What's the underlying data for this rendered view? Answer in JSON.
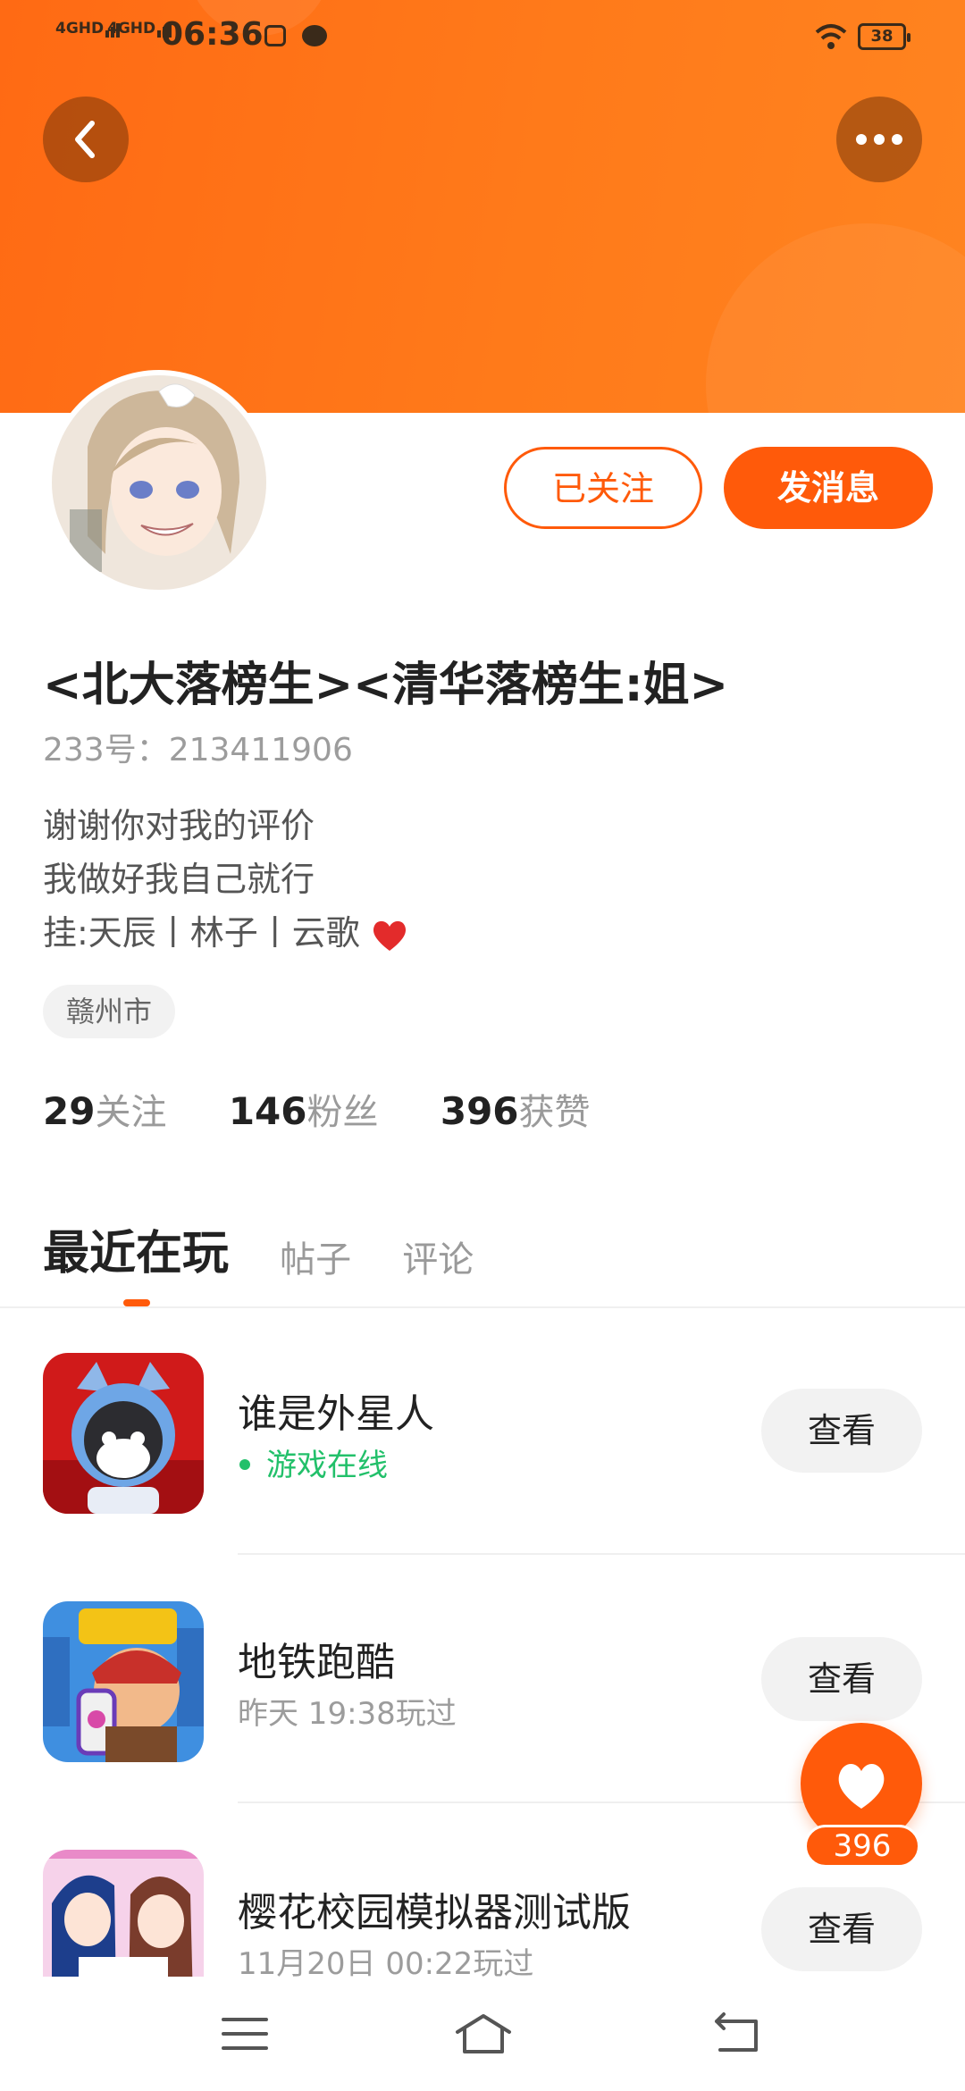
{
  "status_bar": {
    "signal1": "4GHD",
    "signal2": "4GHD",
    "time": "06:36",
    "battery": "38",
    "icons": [
      "app-icon",
      "message-bubble-icon",
      "wifi-icon",
      "battery-icon"
    ]
  },
  "header": {
    "back_icon": "chevron-left-icon",
    "more_icon": "more-dots-icon",
    "banner_color": "#ff7417"
  },
  "profile": {
    "follow_label": "已关注",
    "message_label": "发消息",
    "username": "<北大落榜生><清华落榜生:姐>",
    "uid": "233号：213411906",
    "bio": [
      "谢谢你对我的评价",
      "我做好我自己就行",
      "挂:天辰丨林子丨云歌"
    ],
    "location": "赣州市"
  },
  "stats": [
    {
      "num": "29",
      "label": "关注"
    },
    {
      "num": "146",
      "label": "粉丝"
    },
    {
      "num": "396",
      "label": "获赞"
    }
  ],
  "tabs": [
    {
      "label": "最近在玩",
      "active": true
    },
    {
      "label": "帖子",
      "active": false
    },
    {
      "label": "评论",
      "active": false
    }
  ],
  "games": [
    {
      "name": "谁是外星人",
      "status": "游戏在线",
      "online": true,
      "button": "查看"
    },
    {
      "name": "地铁跑酷",
      "status": "昨天 19:38玩过",
      "online": false,
      "button": "查看"
    },
    {
      "name": "樱花校园模拟器测试版",
      "status": "11月20日 00:22玩过",
      "online": false,
      "button": "查看"
    }
  ],
  "like_fab": {
    "count": "396",
    "icon": "heart-icon"
  },
  "nav": {
    "icons": [
      "menu-icon",
      "home-icon",
      "back-icon"
    ]
  },
  "colors": {
    "accent": "#ff5a0a",
    "online": "#22c06a",
    "muted": "#9c9c9c"
  }
}
